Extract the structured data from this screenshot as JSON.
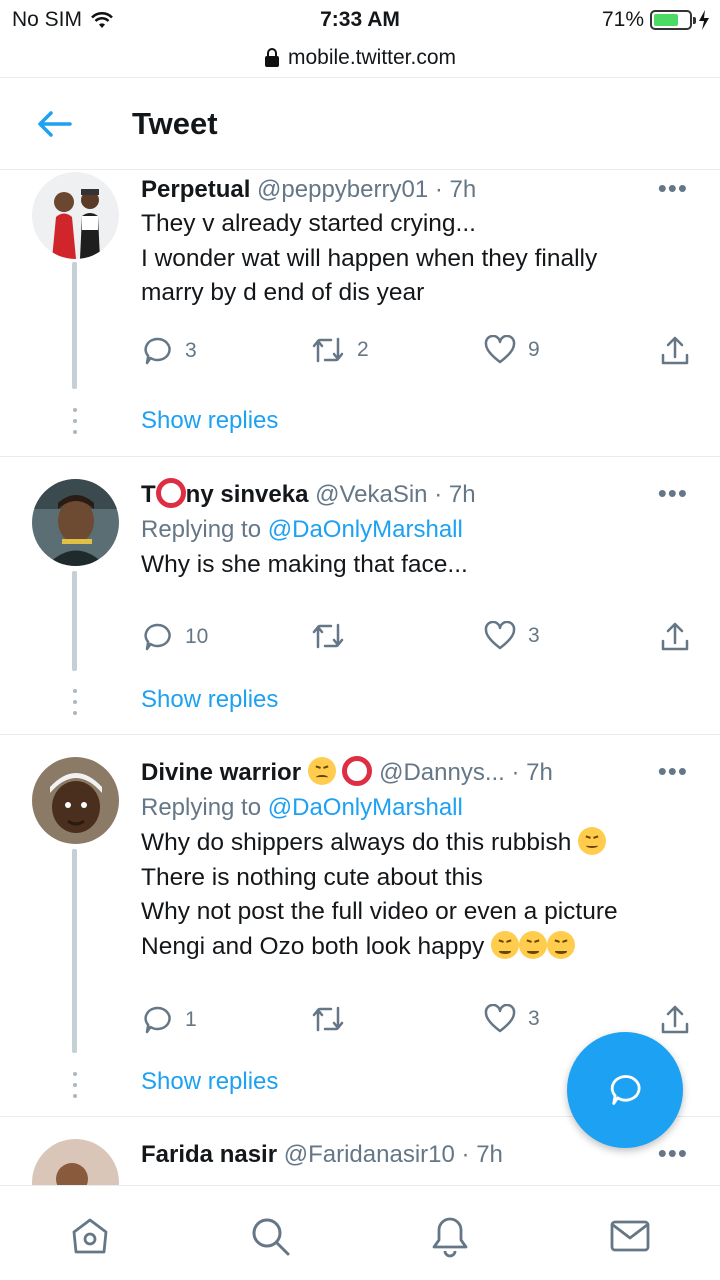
{
  "status_bar": {
    "carrier": "No SIM",
    "time": "7:33 AM",
    "battery": "71%"
  },
  "browser": {
    "url": "mobile.twitter.com"
  },
  "header": {
    "title": "Tweet"
  },
  "tweets": [
    {
      "name": "Perpetual",
      "handle": "@peppyberry01",
      "sep": "·",
      "time": "7h",
      "reply_to_label": "",
      "reply_to_user": "",
      "lines": [
        "They v already started crying...",
        "I wonder wat will happen when they finally",
        "marry by d end of dis year"
      ],
      "replies": "3",
      "retweets": "2",
      "likes": "9",
      "show_replies": "Show replies"
    },
    {
      "name_pre": "T",
      "name_post": "ny sinveka",
      "handle": "@VekaSin",
      "sep": "·",
      "time": "7h",
      "reply_to_label": "Replying to ",
      "reply_to_user": "@DaOnlyMarshall",
      "lines": [
        "Why is she making that face..."
      ],
      "replies": "10",
      "retweets": "",
      "likes": "3",
      "show_replies": "Show replies"
    },
    {
      "name": "Divine warrior",
      "handle": "@Dannys...",
      "sep": "·",
      "time": "7h",
      "reply_to_label": "Replying to ",
      "reply_to_user": "@DaOnlyMarshall",
      "lines": [
        "Why do shippers always do this rubbish",
        "There is nothing cute about this",
        "Why not post the full video or even a picture",
        "Nengi and Ozo both look happy"
      ],
      "replies": "1",
      "retweets": "",
      "likes": "3",
      "show_replies": "Show replies"
    },
    {
      "name": "Farida nasir",
      "handle": "@Faridanasir10",
      "sep": "·",
      "time": "7h"
    }
  ],
  "more_glyph": "•••",
  "colors": {
    "accent": "#1da1f2",
    "secondary_text": "#657786",
    "divider": "#e6ecf0"
  }
}
